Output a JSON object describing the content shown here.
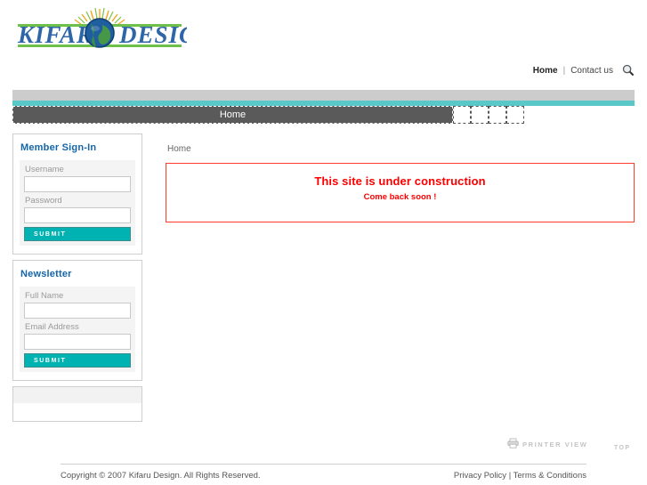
{
  "site": {
    "logo_text_left": "KIFARU",
    "logo_text_right": "DESIGN",
    "logo_icon": "globe-sun-icon"
  },
  "topnav": {
    "home_label": "Home",
    "separator": "|",
    "contact_label": "Contact us",
    "search_icon": "search-icon"
  },
  "mainnav": {
    "items": [
      {
        "label": "Home"
      },
      {
        "label": ""
      },
      {
        "label": ""
      },
      {
        "label": ""
      },
      {
        "label": ""
      }
    ]
  },
  "sidebar": {
    "signin": {
      "title": "Member Sign-In",
      "username_label": "Username",
      "username_value": "",
      "password_label": "Password",
      "password_value": "",
      "submit_label": "SUBMIT"
    },
    "newsletter": {
      "title": "Newsletter",
      "fullname_label": "Full Name",
      "fullname_value": "",
      "email_label": "Email Address",
      "email_value": "",
      "submit_label": "SUBMIT"
    }
  },
  "content": {
    "breadcrumb": "Home",
    "notice_line1": "This site is under construction",
    "notice_line2": "Come back soon !"
  },
  "utility": {
    "printer_icon": "printer-icon",
    "printer_label": "PRINTER VIEW",
    "top_label": "TOP"
  },
  "footer": {
    "copyright": "Copyright © 2007 Kifaru Design. All Rights Reserved.",
    "privacy_label": "Privacy Policy",
    "separator": "|",
    "terms_label": "Terms & Conditions"
  },
  "colors": {
    "accent_teal": "#00b2b2",
    "rule_teal": "#5ac8c8",
    "nav_gray": "#5a5a5a",
    "band_gray": "#cccccc",
    "heading_blue": "#1565a8",
    "alert_red": "#fe0000"
  }
}
